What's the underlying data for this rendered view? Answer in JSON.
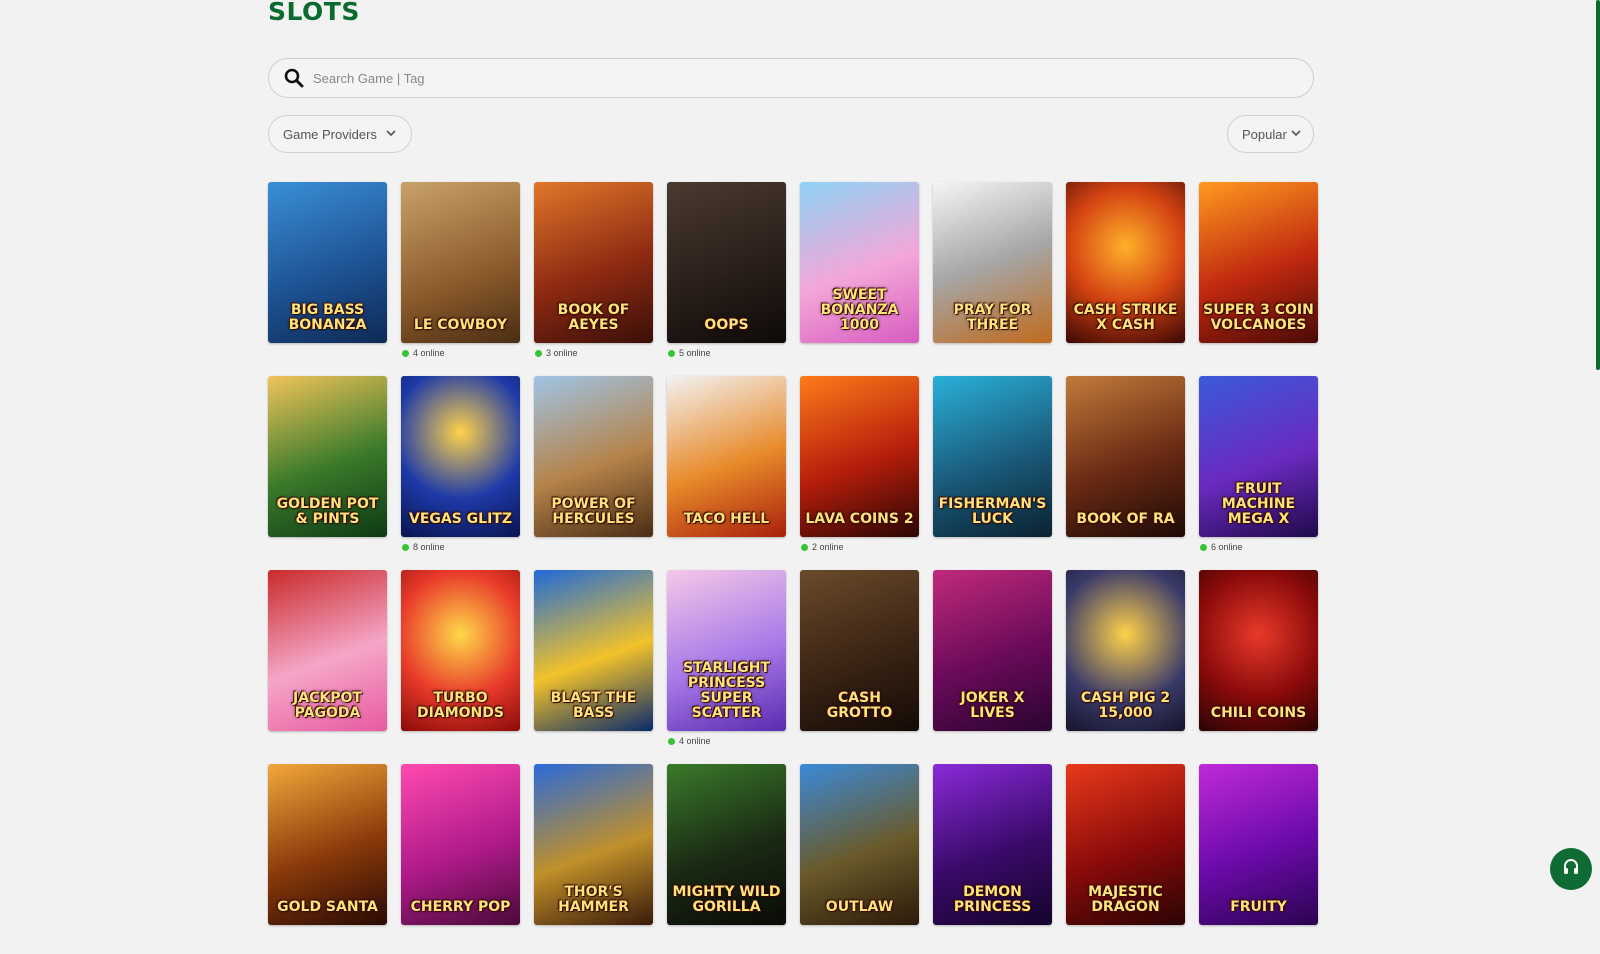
{
  "header": {
    "title": "SLOTS"
  },
  "search": {
    "placeholder": "Search Game | Tag"
  },
  "filters": {
    "providers_label": "Game Providers",
    "sort_label": "Popular"
  },
  "colors": {
    "brand": "#0b6b2e",
    "online_dot": "#36c436",
    "background": "#f2f2f2"
  },
  "games": [
    [
      {
        "name": "Big Bass Bonanza",
        "online": "",
        "bg": "linear-gradient(160deg,#3a8fd6,#1c4f8f 60%,#0e2a55)"
      },
      {
        "name": "Le Cowboy",
        "online": "4 online",
        "bg": "linear-gradient(160deg,#c9a26a,#8a5a2b 60%,#4a2d14)"
      },
      {
        "name": "Book of Aeyes",
        "online": "3 online",
        "bg": "linear-gradient(160deg,#e0772a,#8f2a12 55%,#3a0f08)"
      },
      {
        "name": "Oops",
        "online": "5 online",
        "bg": "linear-gradient(160deg,#4a3a30,#2a1f1a 55%,#0e0a08)"
      },
      {
        "name": "Sweet Bonanza 1000",
        "online": "",
        "bg": "linear-gradient(160deg,#8fd3f5,#f4a6d8 55%,#d65cc0)"
      },
      {
        "name": "Pray for Three",
        "online": "",
        "bg": "linear-gradient(160deg,#f5f5f5,#a6a6a6 50%,#c06a1c)"
      },
      {
        "name": "Cash Strike X Cash",
        "online": "",
        "bg": "radial-gradient(circle at 50% 40%,#ffb12a,#d44312 50%,#3a0704)"
      },
      {
        "name": "Super 3 Coin Volcanoes",
        "online": "",
        "bg": "linear-gradient(160deg,#ff9a1f,#c0280f 55%,#4a0a06)"
      }
    ],
    [
      {
        "name": "Golden Pot & Pints",
        "online": "",
        "bg": "linear-gradient(160deg,#f1c45a,#3a7a2a 55%,#0d3a14)"
      },
      {
        "name": "Vegas Glitz",
        "online": "8 online",
        "bg": "radial-gradient(circle at 50% 35%,#ffd34a,#1e3aa8 55%,#0a1450)"
      },
      {
        "name": "Power of Hercules",
        "online": "",
        "bg": "linear-gradient(160deg,#9fc4e6,#b5834a 55%,#4a2d14)"
      },
      {
        "name": "Taco Hell",
        "online": "",
        "bg": "linear-gradient(160deg,#f2f2f2,#e88a2a 55%,#a8200c)"
      },
      {
        "name": "Lava Coins 2",
        "online": "2 online",
        "bg": "linear-gradient(160deg,#ff7a1a,#b31d0b 55%,#2a0604)"
      },
      {
        "name": "Fisherman's Luck",
        "online": "",
        "bg": "linear-gradient(160deg,#2ab0d9,#1a5a7a 55%,#0a2230)"
      },
      {
        "name": "Book of Ra",
        "online": "",
        "bg": "linear-gradient(160deg,#c27a3a,#6a2a14 55%,#1e0a06)"
      },
      {
        "name": "Fruit Machine Mega X",
        "online": "6 online",
        "bg": "linear-gradient(160deg,#3a5ad9,#6a2ac0 55%,#200a4a)"
      }
    ],
    [
      {
        "name": "Jackpot Pagoda",
        "online": "",
        "bg": "linear-gradient(160deg,#c92a2a,#f5a6c8 55%,#e85aa0)"
      },
      {
        "name": "Turbo Diamonds",
        "online": "",
        "bg": "radial-gradient(circle at 50% 40%,#ffd84a,#e83a2a 55%,#8a0a0a)"
      },
      {
        "name": "Blast the Bass",
        "online": "",
        "bg": "linear-gradient(160deg,#1e6ad9,#f2c22a 55%,#0a2a6a)"
      },
      {
        "name": "Starlight Princess Super Scatter",
        "online": "4 online",
        "bg": "linear-gradient(160deg,#f5c8e8,#a87ae8 55%,#5a2ab0)"
      },
      {
        "name": "Cash Grotto",
        "online": "",
        "bg": "linear-gradient(160deg,#6a4a2a,#3a2414 55%,#140a06)"
      },
      {
        "name": "Joker X Lives",
        "online": "",
        "bg": "linear-gradient(160deg,#c02a7a,#6a0a5a 55%,#2a0430)"
      },
      {
        "name": "Cash Pig 2 15,000",
        "online": "",
        "bg": "radial-gradient(circle at 50% 40%,#ffd24a,#3a3a6a 60%,#14142a)"
      },
      {
        "name": "Chili Coins",
        "online": "",
        "bg": "radial-gradient(circle at 50% 40%,#e83a2a,#8a0a0a 55%,#2a0404)"
      }
    ],
    [
      {
        "name": "Gold Santa",
        "online": "",
        "bg": "linear-gradient(160deg,#f2a83a,#8a3a0a 55%,#2a0a04)"
      },
      {
        "name": "Cherry Pop",
        "online": "",
        "bg": "linear-gradient(160deg,#ff4ab0,#b01a8a 55%,#4a0a3a)"
      },
      {
        "name": "Thor's Hammer",
        "online": "",
        "bg": "linear-gradient(160deg,#2a6ad9,#c0902a 55%,#3a1a0a)"
      },
      {
        "name": "Mighty Wild Gorilla",
        "online": "",
        "bg": "linear-gradient(160deg,#3a7a2a,#1a2a14 55%,#0a0a06)"
      },
      {
        "name": "Outlaw",
        "online": "",
        "bg": "linear-gradient(160deg,#3a8ad9,#6a5a2a 55%,#2a1a0a)"
      },
      {
        "name": "Demon Princess",
        "online": "",
        "bg": "linear-gradient(160deg,#8a2ad9,#3a0a6a 55%,#14042a)"
      },
      {
        "name": "Majestic Dragon",
        "online": "",
        "bg": "linear-gradient(160deg,#e83a1a,#8a0a0a 55%,#2a0404)"
      },
      {
        "name": "Fruity",
        "online": "",
        "bg": "linear-gradient(160deg,#c02ad9,#6a0aa8 55%,#2a0450)"
      }
    ]
  ]
}
